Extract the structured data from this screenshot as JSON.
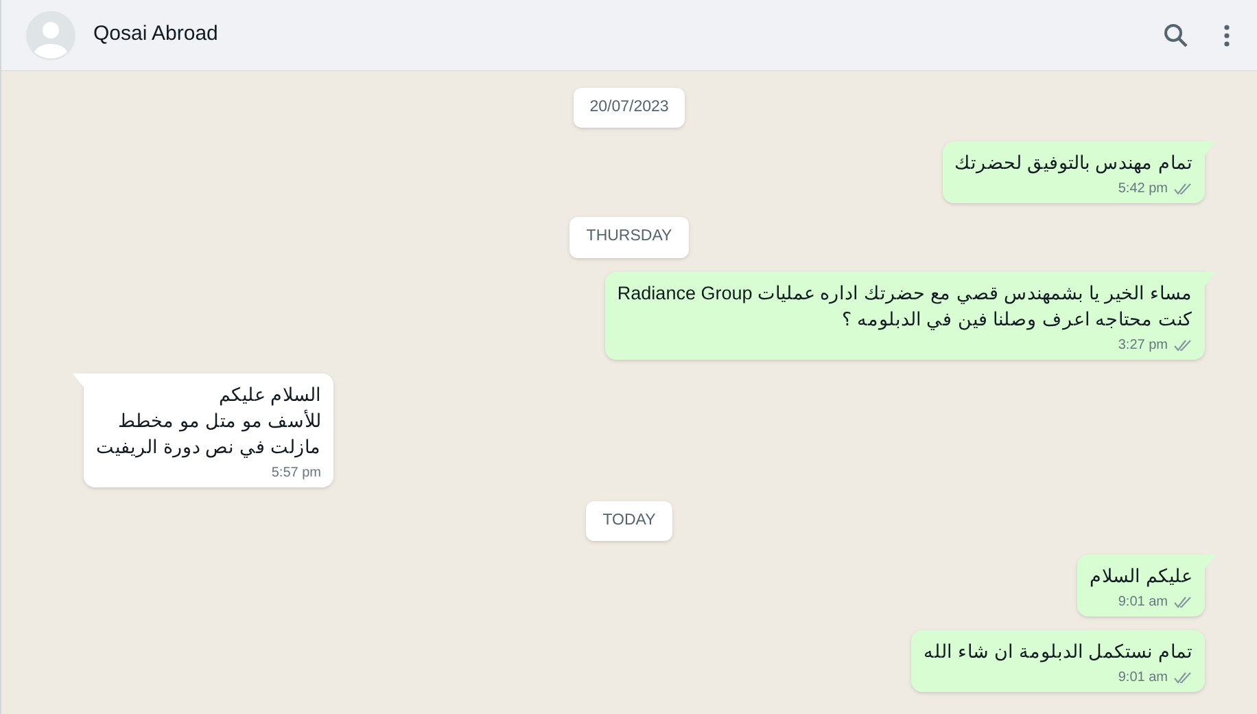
{
  "header": {
    "contact_name": "Qosai Abroad"
  },
  "messages": [
    {
      "kind": "date",
      "text": "20/07/2023"
    },
    {
      "kind": "out",
      "tail": true,
      "lines": [
        "تمام مهندس بالتوفيق لحضرتك"
      ],
      "time": "5:42 pm"
    },
    {
      "kind": "date",
      "text": "THURSDAY"
    },
    {
      "kind": "out",
      "tail": true,
      "lines": [
        "مساء الخير يا بشمهندس قصي مع حضرتك اداره عمليات Radiance Group",
        "كنت محتاجه اعرف وصلنا فين في الدبلومه  ؟"
      ],
      "time": "3:27 pm"
    },
    {
      "kind": "in",
      "tail": true,
      "lines": [
        "السلام عليكم",
        "للأسف مو متل مو مخطط",
        "مازلت في نص دورة الريفيت"
      ],
      "time": "5:57 pm"
    },
    {
      "kind": "date",
      "text": "TODAY"
    },
    {
      "kind": "out",
      "tail": true,
      "lines": [
        "عليكم السلام"
      ],
      "time": "9:01 am"
    },
    {
      "kind": "out",
      "tail": false,
      "lines": [
        "تمام نستكمل الدبلومة ان شاء الله"
      ],
      "time": "9:01 am"
    }
  ]
}
